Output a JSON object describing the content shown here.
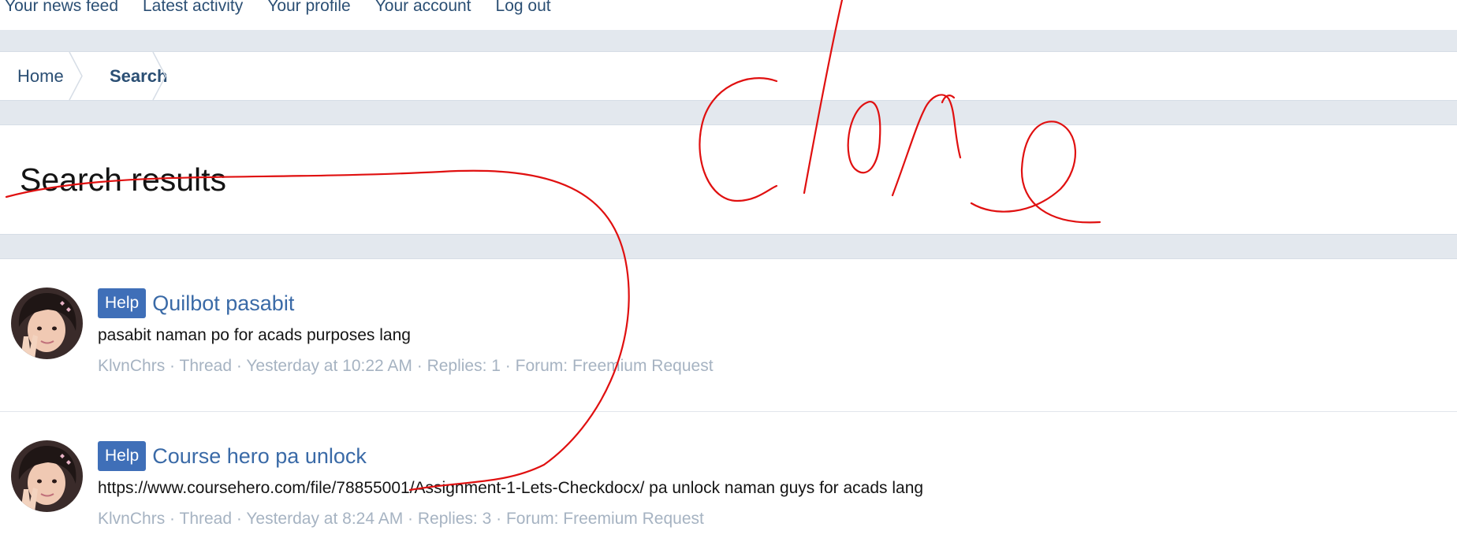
{
  "nav": {
    "links": [
      "Your news feed",
      "Latest activity",
      "Your profile",
      "Your account",
      "Log out"
    ]
  },
  "breadcrumb": {
    "home": "Home",
    "current": "Search"
  },
  "page": {
    "title": "Search results"
  },
  "results": [
    {
      "prefix": "Help",
      "title": "Quilbot pasabit",
      "snippet": "pasabit naman po for acads purposes lang",
      "author": "KlvnChrs",
      "type": "Thread",
      "time": "Yesterday at 10:22 AM",
      "replies": "Replies: 1",
      "forum": "Forum: Freemium Request"
    },
    {
      "prefix": "Help",
      "title": "Course hero pa unlock",
      "snippet": "https://www.coursehero.com/file/78855001/Assignment-1-Lets-Checkdocx/ pa unlock naman guys for acads lang",
      "author": "KlvnChrs",
      "type": "Thread",
      "time": "Yesterday at 8:24 AM",
      "replies": "Replies: 3",
      "forum": "Forum: Freemium Request"
    }
  ],
  "colors": {
    "link": "#2b4f74",
    "accent": "#3f6fb8",
    "meta": "#a6b3c2",
    "annotation": "#e01010"
  },
  "annotation": {
    "text": "done"
  }
}
